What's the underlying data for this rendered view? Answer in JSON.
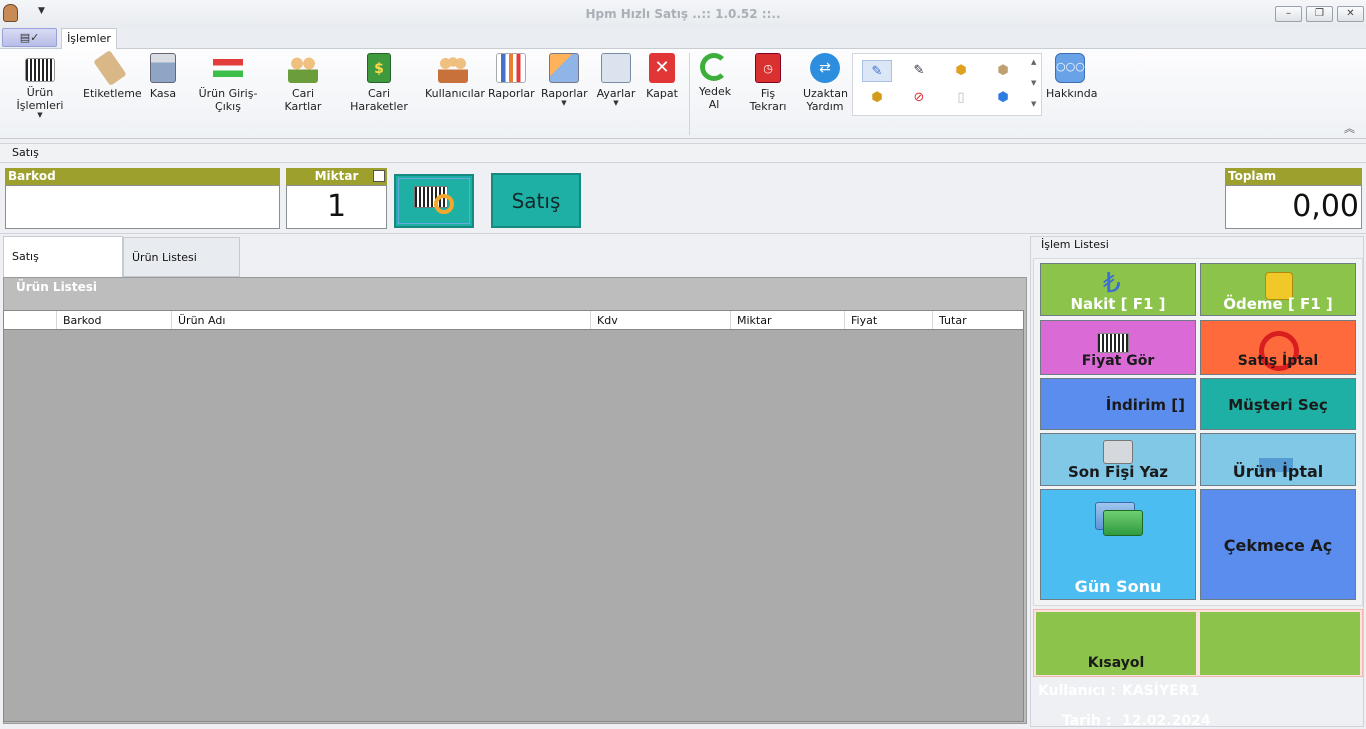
{
  "window": {
    "title": "Hpm Hızlı Satış ..:: 1.0.52 ::..",
    "min": "–",
    "restore": "❐",
    "close": "✕"
  },
  "menu": {
    "app_menu": "▤✓",
    "tab": "İşlemler"
  },
  "ribbon": {
    "buttons": [
      {
        "label": "Ürün İşlemleri",
        "dropdown": "▼",
        "icon": "barcode-icon"
      },
      {
        "label": "Etiketleme",
        "icon": "tag-icon"
      },
      {
        "label": "Kasa",
        "icon": "calculator-icon"
      },
      {
        "label": "Ürün Giriş-Çıkış",
        "icon": "arrows-icon"
      },
      {
        "label": "Cari Kartlar",
        "icon": "users-icon"
      },
      {
        "label": "Cari Haraketler",
        "icon": "money-icon"
      },
      {
        "label": "Kullanıcılar",
        "icon": "group-icon"
      },
      {
        "label": "Raporlar",
        "icon": "chart-icon"
      },
      {
        "label": "Raporlar",
        "dropdown": "▼",
        "icon": "report-icon"
      },
      {
        "label": "Ayarlar",
        "dropdown": "▼",
        "icon": "settings-icon"
      },
      {
        "label": "Kapat",
        "icon": "close-icon"
      },
      {
        "label": "Yedek Al",
        "icon": "refresh-icon"
      },
      {
        "label": "Fiş Tekrarı",
        "icon": "clock-icon"
      },
      {
        "label": "Uzaktan Yardım",
        "icon": "remote-icon"
      },
      {
        "label": "Hakkında",
        "icon": "speech-icon"
      }
    ],
    "qat": [
      "✎",
      "✎",
      "⬢",
      "⬢",
      "⬢",
      "⊘",
      "▯",
      "⬢"
    ],
    "scroll": {
      "up": "▲",
      "mid": "▼",
      "down": "▼"
    },
    "collapse": "︽"
  },
  "section": {
    "title": "Satış"
  },
  "barkod": {
    "label": "Barkod",
    "value": ""
  },
  "miktar": {
    "label": "Miktar",
    "value": "1"
  },
  "satis_button": "Satış",
  "toplam": {
    "label": "Toplam",
    "value": "0,00"
  },
  "tabs": {
    "satis": "Satış",
    "urun_listesi": "Ürün Listesi"
  },
  "grid": {
    "title": "Ürün Listesi",
    "columns": [
      "Barkod",
      "Ürün Adı",
      "Kdv",
      "Miktar",
      "Fiyat",
      "Tutar"
    ]
  },
  "islem": {
    "title": "İşlem Listesi",
    "tiles": {
      "nakit": "Nakit  [ F1 ]",
      "odeme": "Ödeme  [ F1 ]",
      "fiyat_gor": "Fiyat Gör",
      "satis_iptal": "Satış İptal",
      "indirim": "İndirim []",
      "musteri_sec": "Müşteri Seç",
      "son_fisi_yaz": "Son Fişi Yaz",
      "urun_iptal": "Ürün İptal",
      "gun_sonu": "Gün Sonu",
      "cekmece_ac": "Çekmece Aç",
      "kisayol": "Kısayol"
    },
    "lira": "₺"
  },
  "footer": {
    "user_label": "Kullanıcı :",
    "user": "KASİYER1",
    "date_label": "Tarih  :",
    "date": "12.02.2024"
  },
  "colors": {
    "olive": "#9da02c",
    "teal": "#1fb0a5",
    "green": "#8cc34b",
    "blue": "#5b8def",
    "pink": "#d96ad6",
    "orange": "#ff6a3d",
    "lightblue": "#80c8e6",
    "skyblue": "#4cbdf0"
  }
}
